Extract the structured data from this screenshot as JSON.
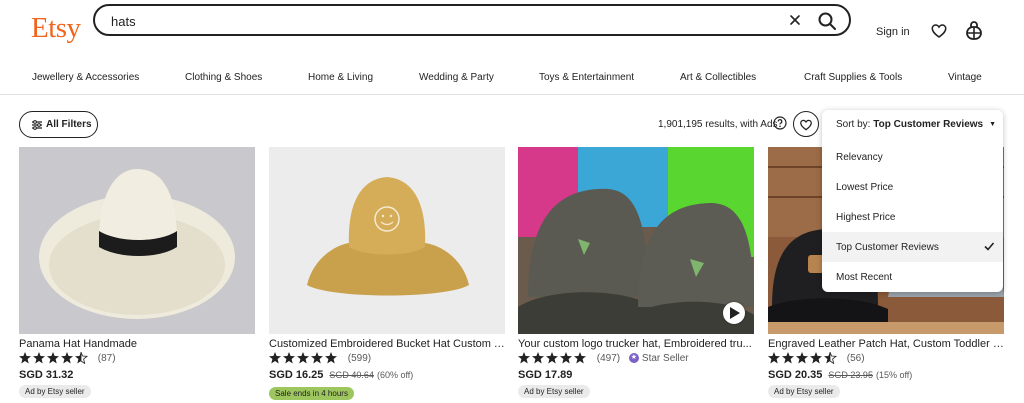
{
  "header": {
    "logo": "Etsy",
    "search_value": "hats",
    "signin_label": "Sign in",
    "icons": [
      "close-icon",
      "search-icon",
      "heart-icon",
      "cart-icon"
    ],
    "brand_color": "#f1641e"
  },
  "categories": [
    "Jewellery & Accessories",
    "Clothing & Shoes",
    "Home & Living",
    "Wedding & Party",
    "Toys & Entertainment",
    "Art & Collectibles",
    "Craft Supplies & Tools",
    "Vintage"
  ],
  "toolbar": {
    "filters_label": "All Filters",
    "results_text": "1,901,195 results, with Ads"
  },
  "sort": {
    "prefix": "Sort by:",
    "current": "Top Customer Reviews",
    "options": [
      "Relevancy",
      "Lowest Price",
      "Highest Price",
      "Top Customer Reviews",
      "Most Recent"
    ],
    "selected": "Top Customer Reviews"
  },
  "listings": [
    {
      "title": "Panama Hat Handmade",
      "rating": 4.5,
      "reviews": "(87)",
      "price": "SGD 31.32",
      "badge": "Ad by Etsy seller"
    },
    {
      "title": "Customized Embroidered Bucket Hat Custom T...",
      "rating": 5,
      "reviews": "(599)",
      "price": "SGD 16.25",
      "original_price": "SGD 40.64",
      "discount": "(60% off)",
      "sale_badge": "Sale ends in 4 hours"
    },
    {
      "title": "Your custom logo trucker hat, Embroidered tru...",
      "rating": 5,
      "reviews": "(497)",
      "star_seller": "Star Seller",
      "price": "SGD 17.89",
      "badge": "Ad by Etsy seller"
    },
    {
      "title": "Engraved Leather Patch Hat, Custom Toddler H...",
      "rating": 4.5,
      "reviews": "(56)",
      "price": "SGD 20.35",
      "original_price": "SGD 23.95",
      "discount": "(15% off)",
      "badge": "Ad by Etsy seller"
    }
  ]
}
